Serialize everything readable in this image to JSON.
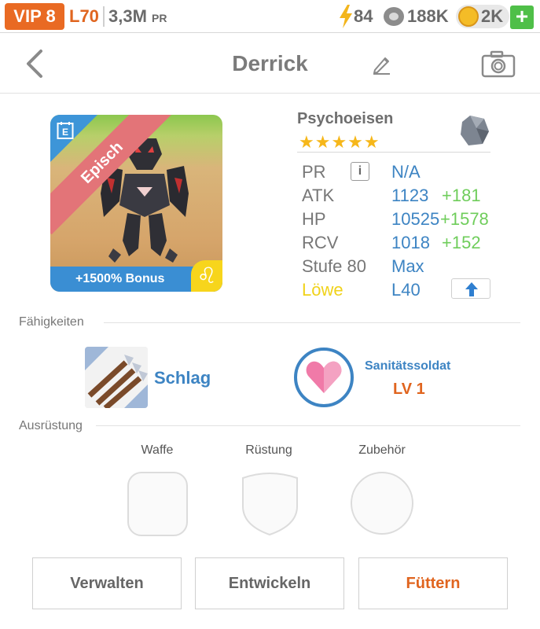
{
  "status_bar": {
    "vip": "VIP 8",
    "level": "L70",
    "power": "3,3M",
    "power_unit": "PR",
    "energy": "84",
    "food": "188K",
    "gold": "2K",
    "add_label": "+"
  },
  "header": {
    "title": "Derrick"
  },
  "card": {
    "rarity": "Episch",
    "bonus": "+1500% Bonus",
    "sign_glyph": "♌"
  },
  "monster": {
    "name": "Psychoeisen",
    "stars": "★★★★★",
    "star_count": 5
  },
  "stats": {
    "pr_label": "PR",
    "pr_value": "N/A",
    "info_label": "i",
    "atk_label": "ATK",
    "atk_value": "1123",
    "atk_bonus": "+181",
    "hp_label": "HP",
    "hp_value": "10525",
    "hp_bonus": "+1578",
    "rcv_label": "RCV",
    "rcv_value": "1018",
    "rcv_bonus": "+152",
    "stufe_label": "Stufe 80",
    "stufe_value": "Max",
    "sign_label": "Löwe",
    "sign_level": "L40"
  },
  "skills": {
    "section": "Fähigkeiten",
    "active_name": "Schlag",
    "passive_name": "Sanitätssoldat",
    "passive_level": "LV 1"
  },
  "equipment": {
    "section": "Ausrüstung",
    "weapon": "Waffe",
    "armor": "Rüstung",
    "accessory": "Zubehör"
  },
  "actions": {
    "manage": "Verwalten",
    "evolve": "Entwickeln",
    "feed": "Füttern"
  },
  "colors": {
    "accent_orange": "#e0651f",
    "accent_blue": "#3d84c3",
    "bonus_green": "#6fcd5b",
    "sign_yellow": "#f0d21a"
  }
}
